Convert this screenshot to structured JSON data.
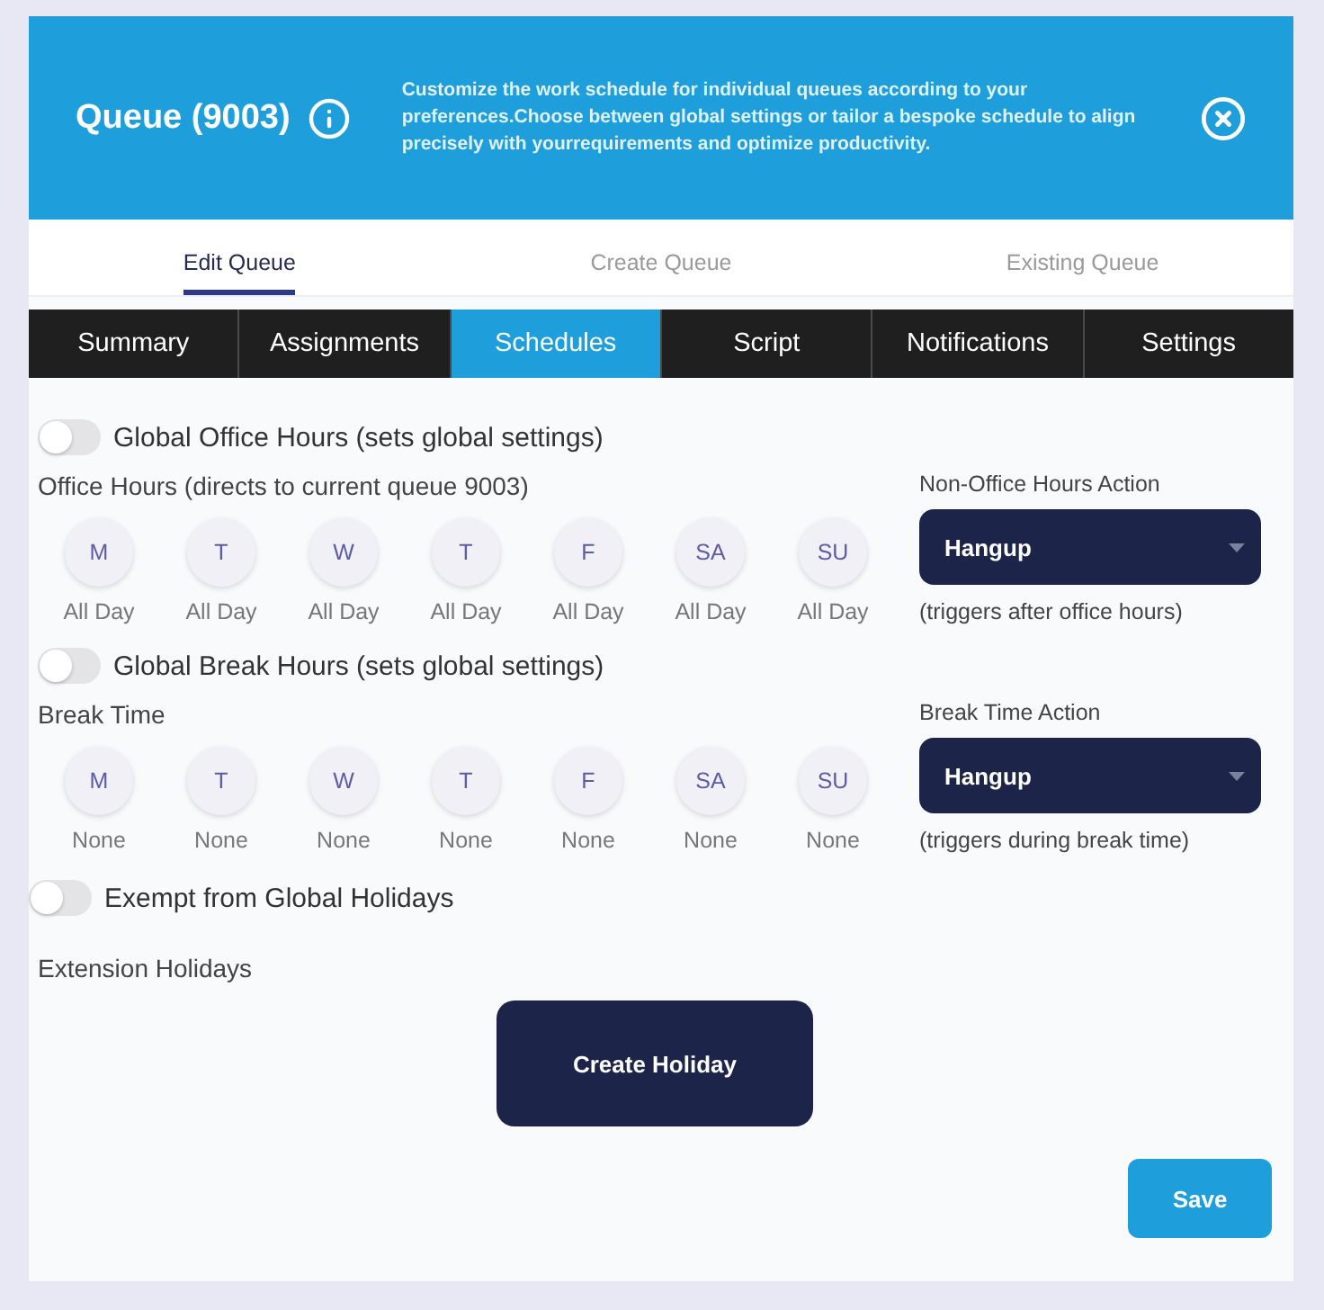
{
  "header": {
    "title": "Queue (9003)",
    "description": "Customize the work schedule for individual queues according to your preferences.Choose between global settings or tailor a bespoke schedule to align precisely with yourrequirements and optimize productivity."
  },
  "tabs": [
    {
      "label": "Edit Queue",
      "selected": true
    },
    {
      "label": "Create Queue",
      "selected": false
    },
    {
      "label": "Existing Queue",
      "selected": false
    }
  ],
  "nav": [
    {
      "label": "Summary",
      "selected": false
    },
    {
      "label": "Assignments",
      "selected": false
    },
    {
      "label": "Schedules",
      "selected": true
    },
    {
      "label": "Script",
      "selected": false
    },
    {
      "label": "Notifications",
      "selected": false
    },
    {
      "label": "Settings",
      "selected": false
    }
  ],
  "schedules": [
    {
      "toggle": {
        "label": "Global Office Hours (sets global settings)",
        "on": false
      },
      "heading": "Office Hours (directs to current queue 9003)",
      "days": [
        {
          "day": "M",
          "value": "All Day"
        },
        {
          "day": "T",
          "value": "All Day"
        },
        {
          "day": "W",
          "value": "All Day"
        },
        {
          "day": "T",
          "value": "All Day"
        },
        {
          "day": "F",
          "value": "All Day"
        },
        {
          "day": "SA",
          "value": "All Day"
        },
        {
          "day": "SU",
          "value": "All Day"
        }
      ],
      "action": {
        "label": "Non-Office Hours Action",
        "value": "Hangup",
        "note": "(triggers after office hours)"
      }
    },
    {
      "toggle": {
        "label": "Global Break Hours (sets global settings)",
        "on": false
      },
      "heading": "Break Time",
      "days": [
        {
          "day": "M",
          "value": "None"
        },
        {
          "day": "T",
          "value": "None"
        },
        {
          "day": "W",
          "value": "None"
        },
        {
          "day": "T",
          "value": "None"
        },
        {
          "day": "F",
          "value": "None"
        },
        {
          "day": "SA",
          "value": "None"
        },
        {
          "day": "SU",
          "value": "None"
        }
      ],
      "action": {
        "label": "Break Time Action",
        "value": "Hangup",
        "note": "(triggers during break time)"
      }
    }
  ],
  "holidays": {
    "toggle": {
      "label": "Exempt from Global Holidays",
      "on": false
    },
    "heading": "Extension Holidays",
    "button": "Create Holiday"
  },
  "save_button": "Save"
}
